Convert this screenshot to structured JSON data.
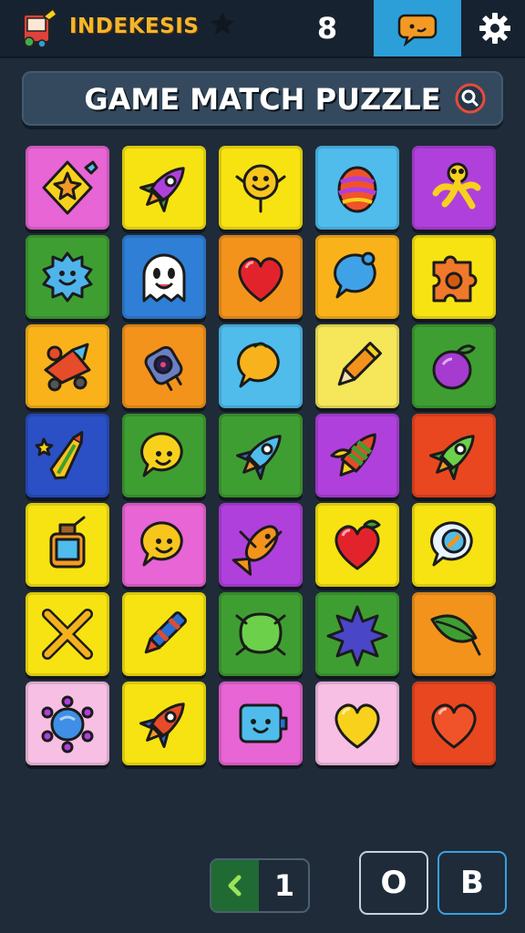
{
  "header": {
    "brand": "INDEKESIS",
    "count": "8",
    "icons": [
      "logo-icon",
      "star-icon",
      "chat-bubble-icon",
      "gear-icon"
    ]
  },
  "banner": {
    "title": "GAME MATCH PUZZLE",
    "icon": "search-icon"
  },
  "colors": {
    "pink": "#e765d4",
    "yellow": "#f7e312",
    "sky": "#4fbcec",
    "purple": "#b040dc",
    "green": "#3f9e32",
    "blue": "#2f7fd6",
    "orange": "#f3931c",
    "amber": "#f9b21a",
    "red": "#e94720",
    "paleyellow": "#f6e65a",
    "lightpink": "#f6bfe3",
    "indigo": "#2b4fc4",
    "accent": "#2c9fd9"
  },
  "board": {
    "rows": [
      [
        {
          "c": "pink",
          "i": "star-kite-icon"
        },
        {
          "c": "yellow",
          "i": "rocket-icon"
        },
        {
          "c": "yellow",
          "i": "smiley-creature-icon"
        },
        {
          "c": "sky",
          "i": "striped-egg-icon"
        },
        {
          "c": "purple",
          "i": "stick-figure-icon"
        }
      ],
      [
        {
          "c": "green",
          "i": "spiky-blob-icon"
        },
        {
          "c": "blue",
          "i": "ghost-icon"
        },
        {
          "c": "orange",
          "i": "heart-icon"
        },
        {
          "c": "amber",
          "i": "speech-bubble-icon"
        },
        {
          "c": "yellow",
          "i": "jigsaw-piece-icon"
        }
      ],
      [
        {
          "c": "amber",
          "i": "toy-rocket-car-icon"
        },
        {
          "c": "orange",
          "i": "robot-gadget-icon"
        },
        {
          "c": "sky",
          "i": "lemon-bubble-icon"
        },
        {
          "c": "paleyellow",
          "i": "pencil-icon"
        },
        {
          "c": "green",
          "i": "plum-icon"
        }
      ],
      [
        {
          "c": "indigo",
          "i": "magic-wand-icon"
        },
        {
          "c": "green",
          "i": "chick-bubble-icon"
        },
        {
          "c": "green",
          "i": "blue-rocket-icon"
        },
        {
          "c": "purple",
          "i": "striped-rocket-icon"
        },
        {
          "c": "red",
          "i": "green-rocket-icon"
        }
      ],
      [
        {
          "c": "yellow",
          "i": "potion-bottle-icon"
        },
        {
          "c": "pink",
          "i": "smiley-bubble-icon"
        },
        {
          "c": "purple",
          "i": "fish-icon"
        },
        {
          "c": "yellow",
          "i": "red-heart-berry-icon"
        },
        {
          "c": "yellow",
          "i": "magnifier-bubble-icon"
        }
      ],
      [
        {
          "c": "yellow",
          "i": "crossed-sticks-icon"
        },
        {
          "c": "yellow",
          "i": "crayon-icon"
        },
        {
          "c": "green",
          "i": "green-blob-icon"
        },
        {
          "c": "green",
          "i": "purple-star-icon"
        },
        {
          "c": "orange",
          "i": "leaf-icon"
        }
      ],
      [
        {
          "c": "lightpink",
          "i": "flower-virus-icon"
        },
        {
          "c": "yellow",
          "i": "red-rocket-icon"
        },
        {
          "c": "pink",
          "i": "box-robot-icon"
        },
        {
          "c": "lightpink",
          "i": "gold-heart-icon"
        },
        {
          "c": "red",
          "i": "orange-heart-icon"
        }
      ]
    ]
  },
  "controls": {
    "back_icon": "chevron-left-icon",
    "page": "1",
    "button_o": "O",
    "button_b": "B"
  }
}
